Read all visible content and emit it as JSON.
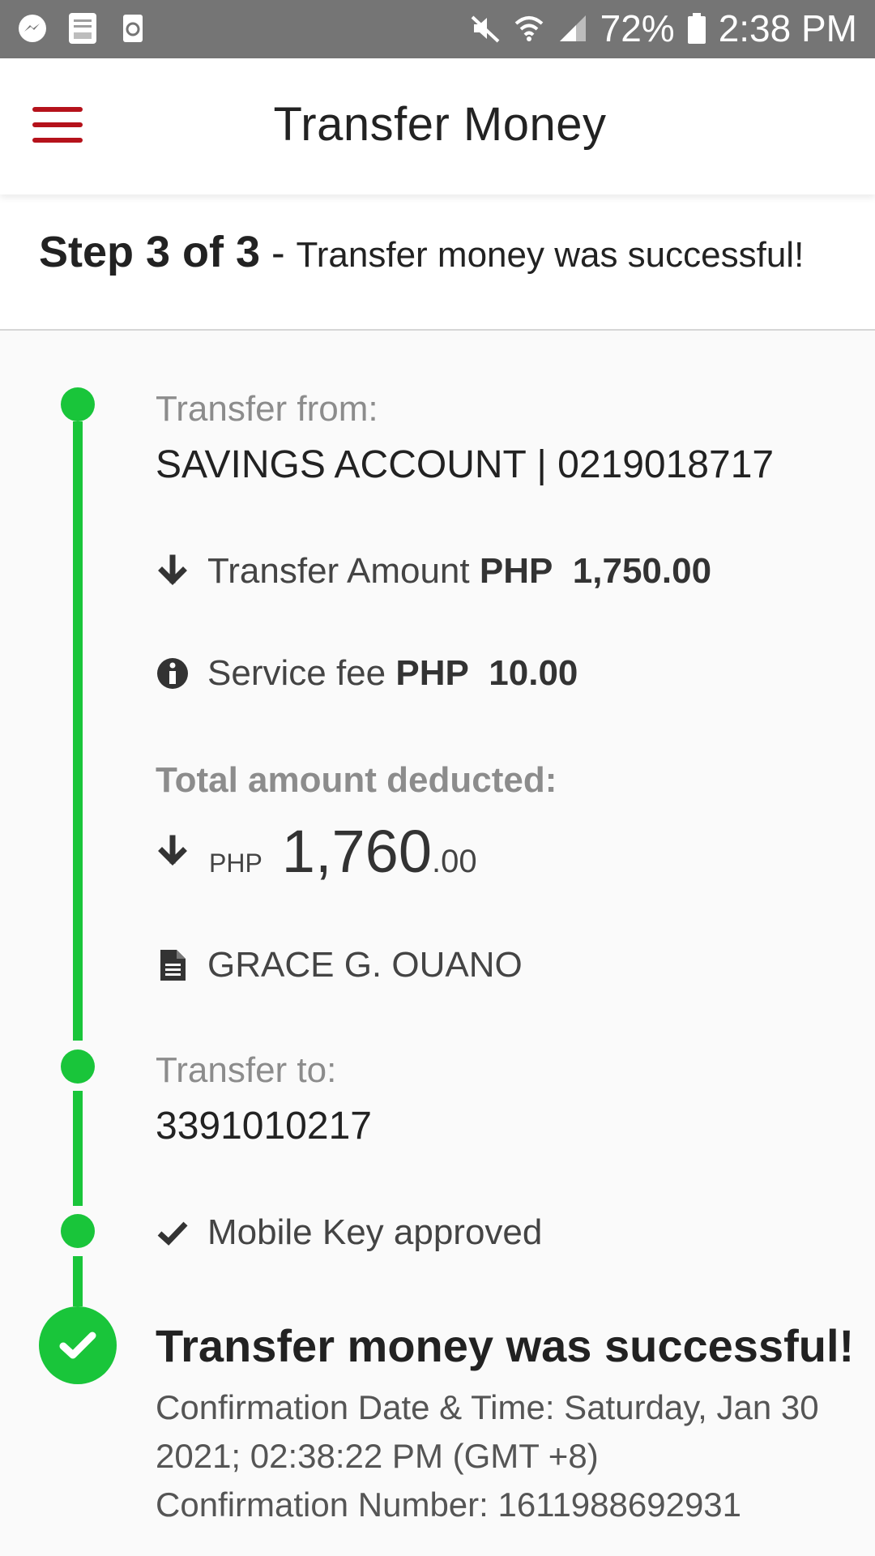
{
  "status_bar": {
    "battery": "72%",
    "time": "2:38 PM",
    "left_icons": [
      "messenger-icon",
      "bible-app-icon",
      "recycle-app-icon"
    ],
    "right_icons": [
      "mute-icon",
      "wifi-icon",
      "signal-icon",
      "battery-icon"
    ]
  },
  "header": {
    "title": "Transfer Money"
  },
  "step": {
    "label": "Step 3 of 3",
    "separator": " - ",
    "description": "Transfer money was successful!"
  },
  "transfer_from": {
    "label": "Transfer from:",
    "account": "SAVINGS ACCOUNT | 0219018717"
  },
  "transfer_amount": {
    "label": "Transfer Amount",
    "currency": "PHP",
    "value": "1,750.00"
  },
  "service_fee": {
    "label": "Service fee",
    "currency": "PHP",
    "value": "10.00"
  },
  "total": {
    "label": "Total amount deducted:",
    "currency": "PHP",
    "whole": "1,760",
    "cents": ".00"
  },
  "recipient_name": "GRACE G. OUANO",
  "transfer_to": {
    "label": "Transfer to:",
    "account": "3391010217"
  },
  "approval": {
    "label": "Mobile Key approved"
  },
  "result": {
    "title": "Transfer money was successful!",
    "confirmation_line1": "Confirmation Date & Time: Saturday, Jan 30",
    "confirmation_line2": "2021; 02:38:22 PM (GMT +8)",
    "confirmation_number": "Confirmation Number: 1611988692931"
  },
  "colors": {
    "accent_red": "#b5121b",
    "success_green": "#19c53a",
    "status_bar": "#757575"
  }
}
